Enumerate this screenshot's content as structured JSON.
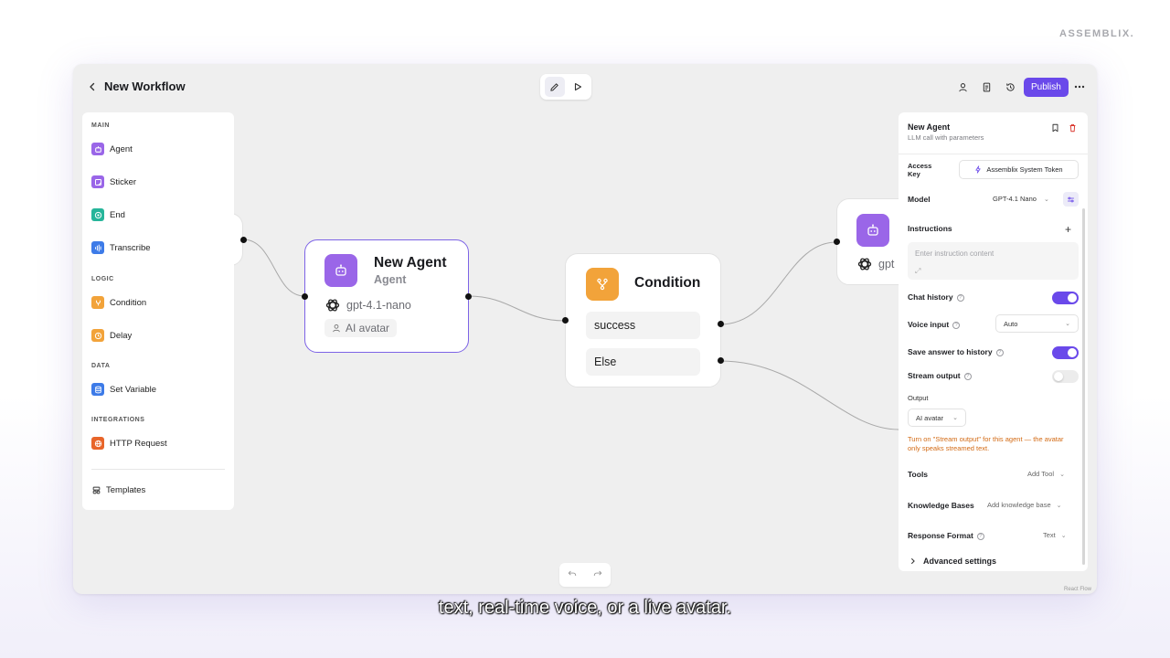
{
  "brand": "ASSEMBLIX.",
  "workflow": {
    "title": "New Workflow"
  },
  "toolbar": {
    "publish_label": "Publish"
  },
  "sidebar": {
    "sections": {
      "main": "MAIN",
      "logic": "LOGIC",
      "data": "DATA",
      "integrations": "INTEGRATIONS"
    },
    "items": {
      "agent": "Agent",
      "sticker": "Sticker",
      "end": "End",
      "transcribe": "Transcribe",
      "condition": "Condition",
      "delay": "Delay",
      "set_variable": "Set Variable",
      "http_request": "HTTP Request"
    },
    "templates": "Templates"
  },
  "nodes": {
    "agent": {
      "title": "New Agent",
      "subtitle": "Agent",
      "model": "gpt-4.1-nano",
      "chip": "AI avatar"
    },
    "condition": {
      "title": "Condition",
      "branches": [
        "success",
        "Else"
      ]
    },
    "partial_agent": {
      "model": "gpt"
    }
  },
  "panel": {
    "title": "New Agent",
    "subtitle": "LLM call with parameters",
    "access_key_label": "Access Key",
    "access_key_value": "Assemblix System Token",
    "model_label": "Model",
    "model_value": "GPT-4.1 Nano",
    "instructions_label": "Instructions",
    "instructions_placeholder": "Enter instruction content",
    "chat_history_label": "Chat history",
    "chat_history_on": true,
    "voice_input_label": "Voice input",
    "voice_input_value": "Auto",
    "save_answer_label": "Save answer to history",
    "save_answer_on": true,
    "stream_output_label": "Stream output",
    "stream_output_on": false,
    "output_label": "Output",
    "output_value": "AI avatar",
    "warning": "Turn on \"Stream output\" for this agent — the avatar only speaks streamed text.",
    "tools_label": "Tools",
    "tools_value": "Add Tool",
    "kb_label": "Knowledge Bases",
    "kb_value": "Add knowledge base",
    "response_format_label": "Response Format",
    "response_format_value": "Text",
    "advanced_label": "Advanced settings"
  },
  "attribution": "React Flow",
  "caption": "text, real-time voice, or a live avatar.",
  "colors": {
    "accent": "#6a49ea",
    "agent_icon": "#9a66e8",
    "condition_icon": "#f2a33a",
    "warning": "#d36a14"
  }
}
